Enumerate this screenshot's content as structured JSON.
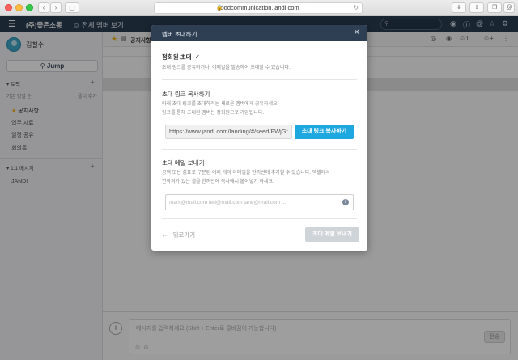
{
  "browser": {
    "url": "goodcommunication.jandi.com"
  },
  "header": {
    "team_name": "(주)좋은소통",
    "all_members": "전체 멤버 보기"
  },
  "sidebar": {
    "user_name": "김철수",
    "jump_label": "Jump",
    "topics_label": "토픽",
    "topics_sub_left": "기본 정렬 순",
    "topics_sub_right": "폴더 추가",
    "topics": [
      "공지사항",
      "업무 자료",
      "일정 공유",
      "회의록"
    ],
    "dm_label": "1:1 메시지",
    "dm_items": [
      "JANDI"
    ]
  },
  "main": {
    "tab_title": "공지사항",
    "member_count": "1",
    "composer_placeholder": "메시지를 입력하세요 (Shift + Enter로 줄바꿈이 가능합니다)",
    "composer_send": "전송"
  },
  "modal": {
    "title": "멤버 초대하기",
    "section1_title": "정회원 초대",
    "section1_desc": "초대 링크를 공유하거나, 이메일을 발송하여 초대할 수 있습니다.",
    "link_title": "초대 링크 복사하기",
    "link_desc1": "아래 초대 링크를 초대하려는 새로운 멤버에게 공유하세요.",
    "link_desc2": "링크를 통해 초대된 멤버는 정회원으로 가입됩니다.",
    "link_url": "https://www.jandi.com/landing/#/seed/FWjGf",
    "copy_button": "초대 링크 복사하기",
    "email_title": "초대 메일 보내기",
    "email_desc1": "공백 또는 쉼표로 구분된 여러 개의 이메일을 한꺼번에 추가할 수 있습니다. 엑셀에서",
    "email_desc2": "연락처가 있는 셀을 한꺼번에 복사해서 붙여넣기 하세요.",
    "email_placeholder": "mark@mail.com ted@mail.com jane@mail.com ...",
    "back_label": "뒤로가기",
    "send_button": "초대 메일 보내기"
  },
  "colors": {
    "header_bg": "#2b3d51",
    "modal_header_bg": "#2f3f53",
    "primary_button": "#1fa7df",
    "disabled_button": "#cfd4d9",
    "star": "#f2b31b"
  }
}
